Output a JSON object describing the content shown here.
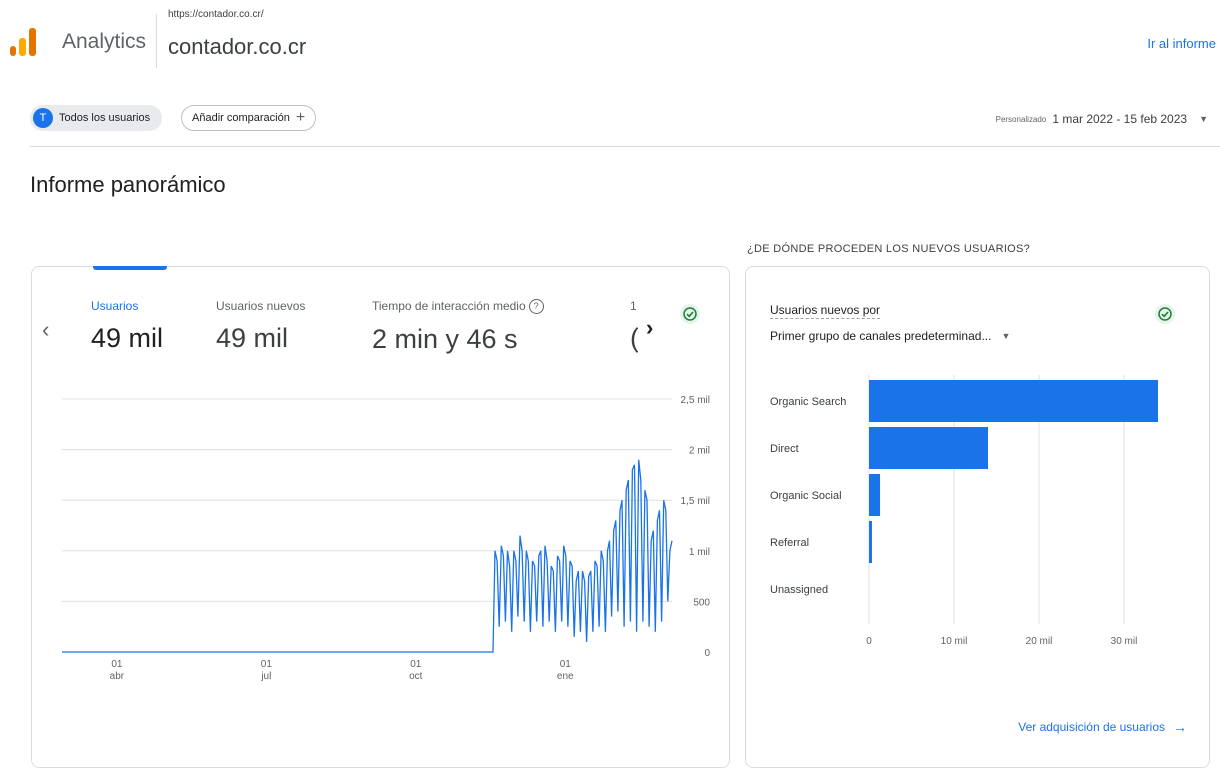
{
  "header": {
    "app_name": "Analytics",
    "property_url": "https://contador.co.cr/",
    "property_name": "contador.co.cr",
    "right_link": "Ir al informe"
  },
  "filters": {
    "segment_badge": "T",
    "segment_label": "Todos los usuarios",
    "add_comparison_label": "Añadir comparación",
    "date_mode": "Personalizado",
    "date_range": "1 mar 2022 - 15 feb 2023"
  },
  "page": {
    "title": "Informe panorámico"
  },
  "metrics": [
    {
      "label": "Usuarios",
      "value": "49 mil"
    },
    {
      "label": "Usuarios nuevos",
      "value": "49 mil"
    },
    {
      "label": "Tiempo de interacción medio",
      "value": "2 min y 46 s"
    },
    {
      "label": "1",
      "value": "("
    }
  ],
  "side_card": {
    "title": "¿DE DÓNDE PROCEDEN LOS NUEVOS USUARIOS?",
    "subtitle_metric": "Usuarios nuevos por",
    "dimension_select": "Primer grupo de canales predeterminad...",
    "link_label": "Ver adquisición de usuarios"
  },
  "colors": {
    "accent": "#1a73e8",
    "check": "#188038"
  },
  "chart_data": [
    {
      "type": "line",
      "series": [
        {
          "values": [
            0,
            0,
            0,
            0,
            0,
            0,
            0,
            0,
            0,
            0,
            0,
            0,
            0,
            0,
            0,
            0,
            0,
            0,
            0,
            0,
            0,
            0,
            0,
            0,
            0,
            0,
            0,
            0,
            0,
            0,
            0,
            0,
            0,
            0,
            0,
            0,
            0,
            0,
            0,
            0,
            0,
            0,
            0,
            0,
            0,
            0,
            0,
            0,
            0,
            0,
            0,
            0,
            0,
            0,
            0,
            0,
            0,
            0,
            0,
            0,
            0,
            0,
            0,
            0,
            0,
            0,
            0,
            0,
            0,
            0,
            0,
            0,
            0,
            0,
            0,
            0,
            0,
            0,
            0,
            0,
            0,
            0,
            0,
            0,
            0,
            0,
            0,
            0,
            0,
            0,
            0,
            0,
            0,
            0,
            0,
            0,
            0,
            0,
            0,
            0,
            0,
            0,
            0,
            0,
            0,
            0,
            0,
            0,
            0,
            0,
            0,
            0,
            0,
            0,
            0,
            0,
            0,
            0,
            0,
            0,
            0,
            0,
            0,
            0,
            0,
            0,
            0,
            0,
            0,
            0,
            0,
            0,
            0,
            0,
            0,
            0,
            0,
            0,
            0,
            0,
            0,
            0,
            0,
            0,
            0,
            0,
            0,
            0,
            0,
            0,
            0,
            0,
            0,
            0,
            0,
            0,
            0,
            0,
            0,
            0,
            0,
            0,
            0,
            0,
            0,
            0,
            0,
            0,
            0,
            0,
            0,
            0,
            0,
            0,
            0,
            0,
            0,
            0,
            0,
            0,
            0,
            0,
            0,
            0,
            0,
            0,
            0,
            0,
            0,
            0,
            0,
            0,
            0,
            0,
            0,
            0,
            0,
            0,
            0,
            0,
            0,
            0,
            0,
            0,
            0,
            0,
            0,
            0,
            1000,
            900,
            250,
            1050,
            950,
            300,
            1000,
            850,
            200,
            1000,
            900,
            350,
            1150,
            1000,
            300,
            1000,
            900,
            200,
            900,
            850,
            300,
            950,
            1000,
            250,
            1050,
            900,
            300,
            850,
            800,
            200,
            950,
            900,
            300,
            1050,
            950,
            250,
            900,
            850,
            150,
            700,
            800,
            200,
            800,
            700,
            100,
            750,
            800,
            200,
            900,
            850,
            250,
            1000,
            900,
            200,
            1000,
            1100,
            350,
            1200,
            1300,
            400,
            1400,
            1500,
            250,
            1600,
            1700,
            300,
            1800,
            1850,
            200,
            1900,
            1700,
            300,
            1600,
            1500,
            250,
            1100,
            1200,
            200,
            1300,
            1400,
            300,
            1500,
            1400,
            500,
            1000,
            1100
          ]
        }
      ],
      "x_tick_labels": [
        [
          "01",
          "abr"
        ],
        [
          "01",
          "jul"
        ],
        [
          "01",
          "oct"
        ],
        [
          "01",
          "ene"
        ]
      ],
      "y_tick_labels": [
        "0",
        "500",
        "1 mil",
        "1,5 mil",
        "2 mil",
        "2,5 mil"
      ],
      "ylim": [
        0,
        2500
      ],
      "grid": true,
      "legend": "none"
    },
    {
      "type": "bar",
      "orientation": "horizontal",
      "categories": [
        "Organic Search",
        "Direct",
        "Organic Social",
        "Referral",
        "Unassigned"
      ],
      "values": [
        34000,
        14000,
        1300,
        350,
        0
      ],
      "x_tick_labels": [
        "0",
        "10 mil",
        "20 mil",
        "30 mil"
      ],
      "xlim": [
        0,
        34000
      ],
      "grid": true
    }
  ]
}
